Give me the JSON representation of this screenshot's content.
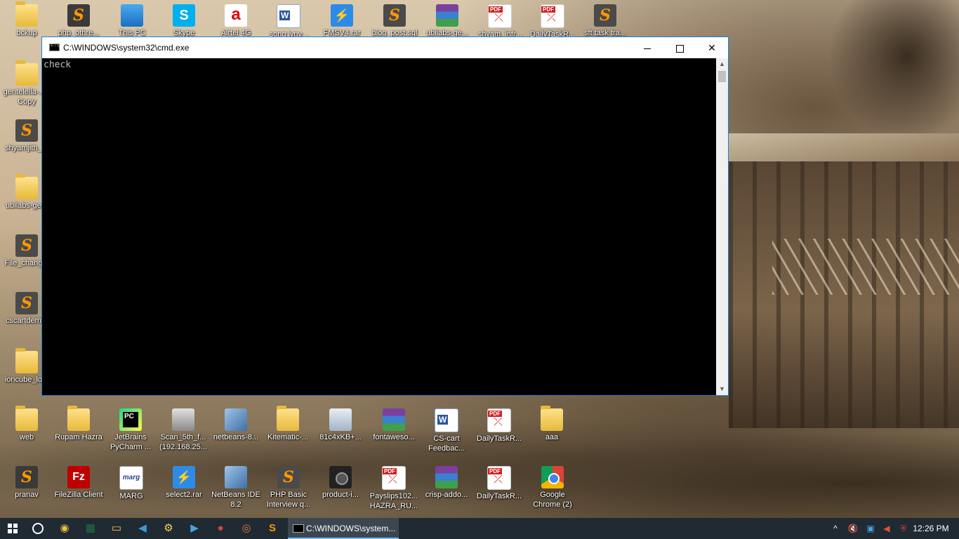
{
  "desktop": {
    "top_row": [
      {
        "label": "bckup",
        "icon": "folder-icon"
      },
      {
        "label": "php_othre...",
        "icon": "archive-icon"
      },
      {
        "label": "This PC",
        "icon": "computer-icon"
      },
      {
        "label": "Skype",
        "icon": "skype-icon"
      },
      {
        "label": "Airtel 4G",
        "icon": "airtel-icon"
      },
      {
        "label": "song lyny...",
        "icon": "word-doc-icon"
      },
      {
        "label": "FMSV4.rar",
        "icon": "bolt-icon"
      },
      {
        "label": "blog_post.sql",
        "icon": "sublime-icon"
      },
      {
        "label": "ubilabs-ge...",
        "icon": "winrar-icon"
      },
      {
        "label": "shyam_infr...",
        "icon": "pdf-icon"
      },
      {
        "label": "DailyTaskR...",
        "icon": "pdf-icon"
      },
      {
        "label": "sft task tra...",
        "icon": "sublime-icon"
      }
    ],
    "left_column": [
      {
        "label": "gentelella-... - Copy",
        "icon": "folder-icon"
      },
      {
        "label": "shyamjith_...",
        "icon": "sublime-icon"
      },
      {
        "label": "ubilabs-ge...",
        "icon": "folder-icon"
      },
      {
        "label": "File_chang...",
        "icon": "sublime-icon"
      },
      {
        "label": "cscartdem...",
        "icon": "sublime-icon"
      },
      {
        "label": "ioncube_lo...",
        "icon": "folder-icon"
      }
    ],
    "row_a": [
      {
        "label": "web",
        "icon": "folder-icon"
      },
      {
        "label": "Rupam Hazra",
        "icon": "user-folder-icon"
      },
      {
        "label": "JetBrains PyCharm ...",
        "icon": "pycharm-icon"
      },
      {
        "label": "Scan_5th_f... (192.168.25...",
        "icon": "scanner-icon"
      },
      {
        "label": "netbeans-8...",
        "icon": "installer-icon"
      },
      {
        "label": "Kitematic-...",
        "icon": "folder-icon"
      },
      {
        "label": "81c4xKB+...",
        "icon": "image-icon"
      },
      {
        "label": "fontaweso...",
        "icon": "winrar-icon"
      },
      {
        "label": "CS-cart Feedbac...",
        "icon": "word-doc-icon"
      },
      {
        "label": "DailyTaskR...",
        "icon": "pdf-icon"
      },
      {
        "label": "aaa",
        "icon": "folder-icon"
      }
    ],
    "row_b": [
      {
        "label": "pranav",
        "icon": "archive-icon"
      },
      {
        "label": "FileZilla Client",
        "icon": "filezilla-icon"
      },
      {
        "label": "MARG",
        "icon": "marg-icon"
      },
      {
        "label": "select2.rar",
        "icon": "bolt-icon"
      },
      {
        "label": "NetBeans IDE 8.2",
        "icon": "netbeans-icon"
      },
      {
        "label": "PHP Basic Interview q...",
        "icon": "sublime-icon"
      },
      {
        "label": "product-i...",
        "icon": "camera-icon"
      },
      {
        "label": "Payslips102... HAZRA_RU...",
        "icon": "pdf-icon"
      },
      {
        "label": "crisp-addo...",
        "icon": "winrar-icon"
      },
      {
        "label": "DailyTaskR...",
        "icon": "pdf-icon"
      },
      {
        "label": "Google Chrome (2)",
        "icon": "chrome-icon"
      }
    ]
  },
  "cmd_window": {
    "title": "C:\\WINDOWS\\system32\\cmd.exe",
    "output": "check",
    "minimize_glyph": "—",
    "maximize_glyph": "☐",
    "close_glyph": "✕",
    "scroll_up": "▲",
    "scroll_down": "▼"
  },
  "taskbar": {
    "pinned": [
      {
        "name": "start-button",
        "icon": "windows-logo-icon"
      },
      {
        "name": "search-button",
        "icon": "cortana-circle-icon"
      },
      {
        "name": "taskbar-app-1",
        "icon": "app-icon",
        "glyph": "◉"
      },
      {
        "name": "taskbar-excel",
        "icon": "excel-icon",
        "glyph": "▦"
      },
      {
        "name": "taskbar-explorer",
        "icon": "file-explorer-icon",
        "glyph": "▭"
      },
      {
        "name": "taskbar-vscode",
        "icon": "vscode-icon",
        "glyph": "◀"
      },
      {
        "name": "taskbar-app-2",
        "icon": "app-icon",
        "glyph": "⚙"
      },
      {
        "name": "taskbar-app-3",
        "icon": "app-icon",
        "glyph": "▶"
      },
      {
        "name": "taskbar-chrome",
        "icon": "chrome-icon",
        "glyph": "●"
      },
      {
        "name": "taskbar-app-4",
        "icon": "app-icon",
        "glyph": "◎"
      },
      {
        "name": "taskbar-sublime",
        "icon": "sublime-icon",
        "glyph": "S"
      }
    ],
    "active_app": "C:\\WINDOWS\\system...",
    "tray": {
      "chevron": "^",
      "clock": "12:26 PM"
    }
  },
  "colors": {
    "accent": "#1883d7",
    "taskbar": "#202a33",
    "console_bg": "#000000",
    "console_text": "#c0c0c0"
  }
}
